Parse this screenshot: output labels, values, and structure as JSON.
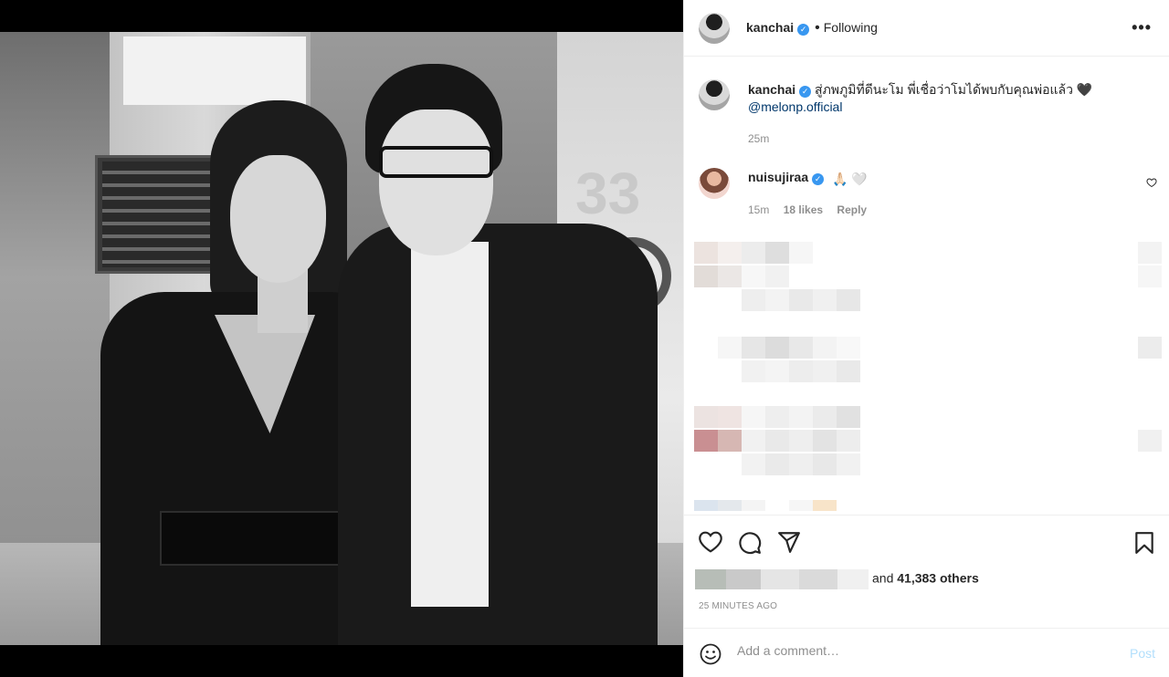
{
  "post": {
    "username": "kanchai",
    "verified_icon": "verified-badge-icon",
    "separator": "•",
    "follow_status": "Following",
    "more_icon": "more-options-icon",
    "more_label": "•••"
  },
  "caption": {
    "username": "kanchai",
    "text": "สู่ภพภูมิที่ดีนะโม พี่เชื่อว่าโมได้พบกับคุณพ่อแล้ว 🖤",
    "mention": "@melonp.official",
    "time": "25m"
  },
  "comment": {
    "username": "nuisujiraa",
    "text": "🙏🏻 🤍",
    "time": "15m",
    "likes": "18 likes",
    "reply": "Reply"
  },
  "actions": {
    "like_icon": "heart-icon",
    "comment_icon": "comment-icon",
    "share_icon": "share-icon",
    "save_icon": "bookmark-icon",
    "likes_suffix": "and",
    "likes_count": "41,383 others",
    "posted_ago": "25 MINUTES AGO"
  },
  "add_comment": {
    "emoji_icon": "emoji-icon",
    "placeholder": "Add a comment…",
    "post_label": "Post"
  },
  "colors": {
    "verified": "#3897f0",
    "link": "#00376b",
    "muted": "#8e8e8e",
    "post_disabled": "#b2dffc"
  }
}
